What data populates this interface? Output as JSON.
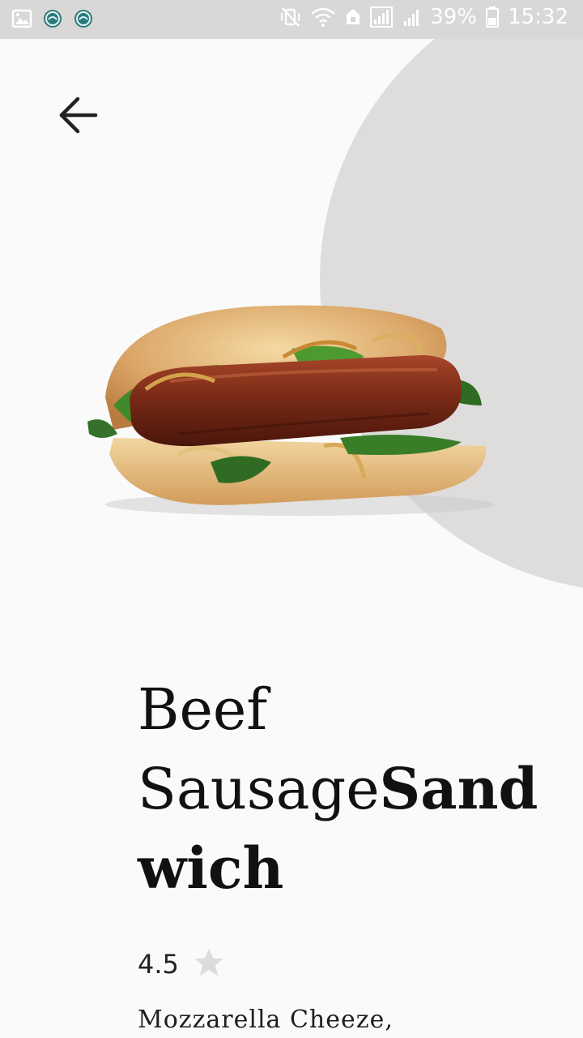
{
  "status_bar": {
    "battery_text": "39%",
    "time": "15:32",
    "left_icons": [
      "gallery-icon",
      "app-notification-icon",
      "app-notification-icon"
    ],
    "right_icons": [
      "mute-vibrate-icon",
      "wifi-icon",
      "data-saver-icon",
      "signal-icon",
      "signal-icon",
      "battery-icon"
    ]
  },
  "header": {
    "back_icon": "arrow-back-icon"
  },
  "product": {
    "image_name": "beef-sausage-sandwich-image",
    "title_light": "Beef SausageSand",
    "title_bold": "wich",
    "title_part1": "Beef",
    "title_part2_light": "Sausage",
    "title_part2_bold": "Sand",
    "title_part3_bold": "wich",
    "rating": "4.5",
    "rating_icon": "star-icon",
    "description": "Mozzarella Cheeze,"
  },
  "colors": {
    "background": "#fafafa",
    "status_bar": "#d9d8d6",
    "blob": "#dedddb",
    "text": "#111111",
    "star": "#dcdcdc"
  }
}
